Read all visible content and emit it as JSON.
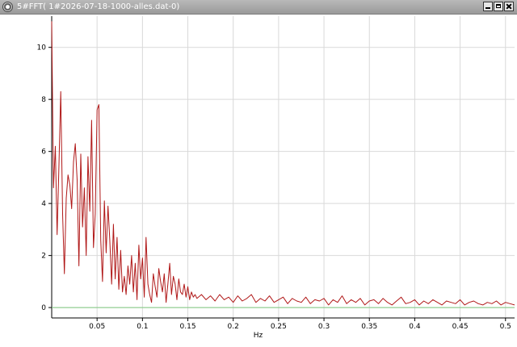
{
  "window": {
    "title": "5#FFT(  1#2026-07-18-1000-alles.dat-0)",
    "buttons": {
      "minimize": "minimize",
      "maximize": "maximize",
      "close": "close"
    }
  },
  "chart_data": {
    "type": "line",
    "title": "",
    "xlabel": "Hz",
    "ylabel": "",
    "xlim": [
      0.0,
      0.51
    ],
    "ylim": [
      -0.4,
      11.2
    ],
    "grid": true,
    "x_ticks": [
      0.05,
      0.1,
      0.15,
      0.2,
      0.25,
      0.3,
      0.35,
      0.4,
      0.45,
      0.5
    ],
    "x_tick_labels": [
      "0.05",
      "0.1",
      "0.15",
      "0.2",
      "0.25",
      "0.3",
      "0.35",
      "0.4",
      "0.45",
      "0.5"
    ],
    "y_ticks": [
      0,
      2,
      4,
      6,
      8,
      10
    ],
    "y_tick_labels": [
      "0",
      "2",
      "4",
      "6",
      "8",
      "10"
    ],
    "colors": {
      "series": "#b01818",
      "baseline": "#7ec87e",
      "grid": "#d9d9d9"
    },
    "baseline_y": 0,
    "series": [
      {
        "x": [
          0.0,
          0.002,
          0.004,
          0.006,
          0.008,
          0.01,
          0.012,
          0.014,
          0.016,
          0.018,
          0.02,
          0.022,
          0.024,
          0.026,
          0.028,
          0.03,
          0.032,
          0.034,
          0.036,
          0.038,
          0.04,
          0.042,
          0.044,
          0.046,
          0.048,
          0.05,
          0.052,
          0.054,
          0.056,
          0.058,
          0.06,
          0.062,
          0.064,
          0.066,
          0.068,
          0.07,
          0.072,
          0.074,
          0.076,
          0.078,
          0.08,
          0.082,
          0.084,
          0.086,
          0.088,
          0.09,
          0.092,
          0.094,
          0.096,
          0.098,
          0.1,
          0.102,
          0.104,
          0.106,
          0.108,
          0.11,
          0.112,
          0.114,
          0.116,
          0.118,
          0.12,
          0.122,
          0.124,
          0.126,
          0.128,
          0.13,
          0.132,
          0.134,
          0.136,
          0.138,
          0.14,
          0.142,
          0.144,
          0.146,
          0.148,
          0.15,
          0.152,
          0.154,
          0.156,
          0.158,
          0.16,
          0.165,
          0.17,
          0.175,
          0.18,
          0.185,
          0.19,
          0.195,
          0.2,
          0.205,
          0.21,
          0.215,
          0.22,
          0.225,
          0.23,
          0.235,
          0.24,
          0.245,
          0.25,
          0.255,
          0.26,
          0.265,
          0.27,
          0.275,
          0.28,
          0.285,
          0.29,
          0.295,
          0.3,
          0.305,
          0.31,
          0.315,
          0.32,
          0.325,
          0.33,
          0.335,
          0.34,
          0.345,
          0.35,
          0.355,
          0.36,
          0.365,
          0.37,
          0.375,
          0.38,
          0.385,
          0.39,
          0.395,
          0.4,
          0.405,
          0.41,
          0.415,
          0.42,
          0.425,
          0.43,
          0.435,
          0.44,
          0.445,
          0.45,
          0.455,
          0.46,
          0.465,
          0.47,
          0.475,
          0.48,
          0.485,
          0.49,
          0.495,
          0.5,
          0.505,
          0.51
        ],
        "y": [
          11.0,
          4.6,
          6.2,
          2.8,
          5.5,
          8.3,
          3.6,
          1.3,
          4.2,
          5.1,
          4.7,
          3.8,
          5.6,
          6.3,
          4.9,
          1.6,
          5.9,
          3.1,
          4.6,
          2.0,
          5.8,
          3.7,
          7.2,
          2.3,
          3.6,
          7.6,
          7.8,
          2.6,
          1.0,
          4.1,
          2.1,
          3.9,
          2.6,
          0.9,
          3.2,
          1.1,
          2.7,
          0.7,
          2.2,
          0.6,
          1.2,
          0.5,
          1.6,
          0.9,
          2.0,
          0.6,
          1.7,
          0.3,
          2.4,
          1.1,
          1.9,
          0.4,
          2.7,
          0.9,
          0.5,
          0.2,
          1.3,
          0.8,
          0.4,
          1.5,
          1.0,
          0.6,
          1.3,
          0.2,
          0.9,
          1.7,
          0.5,
          1.2,
          0.9,
          0.3,
          1.1,
          0.6,
          0.5,
          0.9,
          0.4,
          0.8,
          0.3,
          0.6,
          0.4,
          0.5,
          0.35,
          0.5,
          0.3,
          0.45,
          0.25,
          0.5,
          0.3,
          0.4,
          0.2,
          0.45,
          0.25,
          0.35,
          0.5,
          0.2,
          0.35,
          0.25,
          0.45,
          0.2,
          0.3,
          0.4,
          0.15,
          0.35,
          0.25,
          0.2,
          0.4,
          0.15,
          0.3,
          0.25,
          0.35,
          0.1,
          0.3,
          0.2,
          0.45,
          0.15,
          0.3,
          0.2,
          0.35,
          0.1,
          0.25,
          0.3,
          0.15,
          0.35,
          0.2,
          0.1,
          0.25,
          0.4,
          0.15,
          0.2,
          0.3,
          0.1,
          0.25,
          0.15,
          0.3,
          0.2,
          0.1,
          0.25,
          0.2,
          0.15,
          0.3,
          0.1,
          0.2,
          0.25,
          0.15,
          0.1,
          0.2,
          0.15,
          0.25,
          0.1,
          0.2,
          0.15,
          0.1
        ]
      }
    ]
  }
}
